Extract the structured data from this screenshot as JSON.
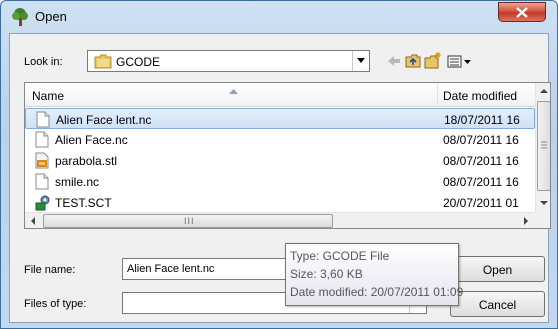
{
  "window": {
    "title": "Open",
    "close_icon": "close-icon",
    "app_icon": "tree-icon"
  },
  "lookin": {
    "label": "Look in:",
    "value": "GCODE",
    "icon": "folder-icon"
  },
  "toolbar": {
    "back_icon": "back-arrow-icon",
    "up_icon": "up-folder-icon",
    "newfolder_icon": "new-folder-icon",
    "views_icon": "views-menu-icon"
  },
  "filelist": {
    "headers": {
      "name": "Name",
      "date": "Date modified"
    },
    "rows": [
      {
        "name": "Alien Face lent.nc",
        "date": "18/07/2011 16",
        "icon": "document-icon",
        "selected": true
      },
      {
        "name": "Alien Face.nc",
        "date": "08/07/2011 16",
        "icon": "document-icon",
        "selected": false
      },
      {
        "name": "parabola.stl",
        "date": "08/07/2011 16",
        "icon": "stl-file-icon",
        "selected": false
      },
      {
        "name": "smile.nc",
        "date": "08/07/2011 16",
        "icon": "document-icon",
        "selected": false
      },
      {
        "name": "TEST.SCT",
        "date": "20/07/2011 01",
        "icon": "script-file-icon",
        "selected": false
      }
    ],
    "hscroll_grip": "III"
  },
  "filename": {
    "label": "File name:",
    "value": "Alien Face lent.nc"
  },
  "filetype": {
    "label": "Files of type:",
    "value": ""
  },
  "buttons": {
    "open": "Open",
    "cancel": "Cancel"
  },
  "tooltip": {
    "type": "Type: GCODE File",
    "size": "Size: 3,60 KB",
    "modified": "Date modified: 20/07/2011 01:09"
  },
  "colors": {
    "selection": "#cfe1f6",
    "close": "#c0392b",
    "titlebar": "#b9d1ea"
  }
}
